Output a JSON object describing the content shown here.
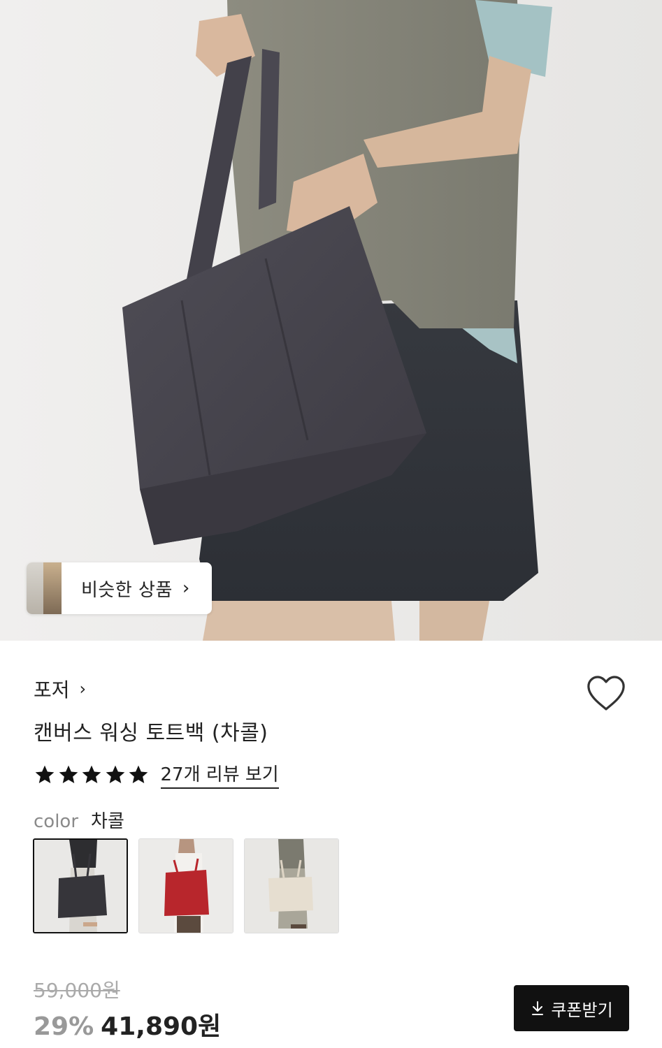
{
  "hero": {
    "image_alt": "",
    "similar_products_label": "비슷한 상품",
    "similar_chevron": "›"
  },
  "brand": {
    "name": "포저",
    "chevron": "›"
  },
  "wishlist": {
    "icon": "heart-outline-icon"
  },
  "product": {
    "title": "캔버스 워싱 토트백 (차콜)"
  },
  "rating": {
    "stars": 5,
    "review_link": "27개 리뷰 보기"
  },
  "color_option": {
    "label": "color",
    "selected_value": "차콜",
    "swatches": [
      {
        "name": "charcoal",
        "color": "#3a3a3d",
        "selected": true
      },
      {
        "name": "red",
        "color": "#b8262c",
        "selected": false
      },
      {
        "name": "ivory",
        "color": "#e6ded0",
        "selected": false
      }
    ]
  },
  "price": {
    "original": "59,000원",
    "discount": "29%",
    "sale": "41,890원"
  },
  "coupon": {
    "icon": "download-icon",
    "label": "쿠폰받기"
  }
}
